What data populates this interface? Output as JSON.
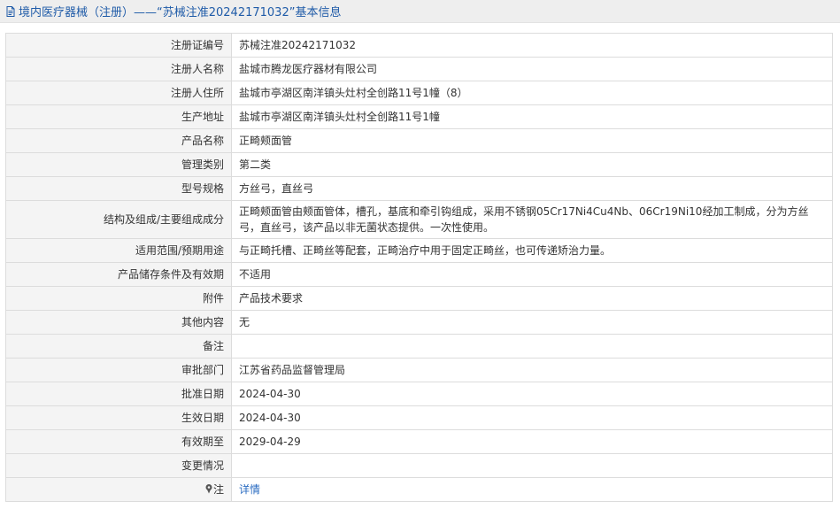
{
  "page": {
    "title": "境内医疗器械（注册）——“苏械注准20242171032”基本信息"
  },
  "rows": [
    {
      "label": "注册证编号",
      "value": "苏械注准20242171032"
    },
    {
      "label": "注册人名称",
      "value": "盐城市腾龙医疗器材有限公司"
    },
    {
      "label": "注册人住所",
      "value": "盐城市亭湖区南洋镇头灶村全创路11号1幢（8）"
    },
    {
      "label": "生产地址",
      "value": "盐城市亭湖区南洋镇头灶村全创路11号1幢"
    },
    {
      "label": "产品名称",
      "value": "正畸颊面管"
    },
    {
      "label": "管理类别",
      "value": "第二类"
    },
    {
      "label": "型号规格",
      "value": "方丝弓，直丝弓"
    },
    {
      "label": "结构及组成/主要组成成分",
      "value": "正畸颊面管由颊面管体，槽孔，基底和牵引钩组成，采用不锈钢05Cr17Ni4Cu4Nb、06Cr19Ni10经加工制成，分为方丝弓，直丝弓，该产品以非无菌状态提供。一次性使用。"
    },
    {
      "label": "适用范围/预期用途",
      "value": "与正畸托槽、正畸丝等配套，正畸治疗中用于固定正畸丝，也可传递矫治力量。"
    },
    {
      "label": "产品储存条件及有效期",
      "value": "不适用"
    },
    {
      "label": "附件",
      "value": "产品技术要求"
    },
    {
      "label": "其他内容",
      "value": "无"
    },
    {
      "label": "备注",
      "value": ""
    },
    {
      "label": "审批部门",
      "value": "江苏省药品监督管理局"
    },
    {
      "label": "批准日期",
      "value": "2024-04-30"
    },
    {
      "label": "生效日期",
      "value": "2024-04-30"
    },
    {
      "label": "有效期至",
      "value": "2029-04-29"
    },
    {
      "label": "变更情况",
      "value": ""
    }
  ],
  "note": {
    "label": "注",
    "link_text": "详情"
  },
  "colors": {
    "title_text": "#1f5ba8",
    "link": "#2a6bc1",
    "label_bg": "#f4f4f4",
    "border": "#dcdcdc"
  }
}
